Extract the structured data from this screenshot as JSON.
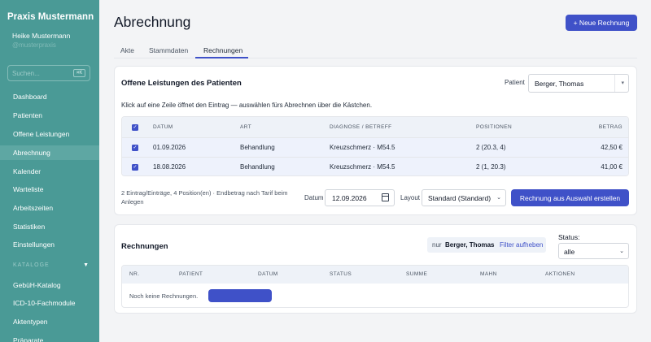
{
  "app": {
    "brand": "Praxis Mustermann",
    "user_name": "Heike Mustermann",
    "user_handle": "@musterpraxis"
  },
  "sidebar": {
    "search_placeholder": "Suchen...",
    "search_shortcut": "⌘K",
    "items": [
      {
        "label": "Dashboard"
      },
      {
        "label": "Patienten"
      },
      {
        "label": "Offene Leistungen"
      },
      {
        "label": "Abrechnung",
        "active": true
      },
      {
        "label": "Kalender"
      },
      {
        "label": "Warteliste"
      },
      {
        "label": "Arbeitszeiten"
      },
      {
        "label": "Statistiken"
      },
      {
        "label": "Einstellungen"
      }
    ],
    "section_label": "KATALOGE",
    "catalog_items": [
      {
        "label": "GebüH-Katalog"
      },
      {
        "label": "ICD-10-Fachmodule"
      },
      {
        "label": "Aktentypen"
      },
      {
        "label": "Präparate"
      }
    ]
  },
  "header": {
    "title": "Abrechnung",
    "new_invoice_label": "+ Neue Rechnung"
  },
  "tabs": [
    {
      "label": "Akte"
    },
    {
      "label": "Stammdaten"
    },
    {
      "label": "Rechnungen",
      "active": true
    }
  ],
  "open_services": {
    "title": "Offene Leistungen des Patienten",
    "patient_label": "Patient",
    "patient_value": "Berger, Thomas",
    "hint": "Klick auf eine Zeile öffnet den Eintrag — auswählen fürs Abrechnen über die Kästchen.",
    "columns": [
      "DATUM",
      "ART",
      "DIAGNOSE / BETREFF",
      "POSITIONEN",
      "BETRAG"
    ],
    "rows": [
      {
        "date": "01.09.2026",
        "type": "Behandlung",
        "diagnosis": "Kreuzschmerz · M54.5",
        "positions": "2 (20.3, 4)",
        "amount": "42,50 €",
        "checked": true
      },
      {
        "date": "18.08.2026",
        "type": "Behandlung",
        "diagnosis": "Kreuzschmerz · M54.5",
        "positions": "2 (1, 20.3)",
        "amount": "41,00 €",
        "checked": true
      }
    ],
    "summary": "2 Eintrag/Einträge, 4 Position(en) · Endbetrag nach Tarif beim Anlegen",
    "date_label": "Datum",
    "date_value": "12.09.2026",
    "layout_label": "Layout",
    "layout_value": "Standard (Standard)",
    "create_label": "Rechnung aus Auswahl erstellen"
  },
  "invoices": {
    "title": "Rechnungen",
    "filter_only": "nur",
    "filter_name": "Berger, Thomas",
    "filter_clear": "Filter aufheben",
    "status_label": "Status:",
    "status_value": "alle",
    "columns": [
      "NR.",
      "PATIENT",
      "DATUM",
      "STATUS",
      "SUMME",
      "MAHN",
      "AKTIONEN"
    ],
    "empty_text": "Noch keine Rechnungen."
  },
  "colors": {
    "sidebar": "#4a9a96",
    "primary": "#3f51c8",
    "row_selected": "#eef2fc"
  }
}
